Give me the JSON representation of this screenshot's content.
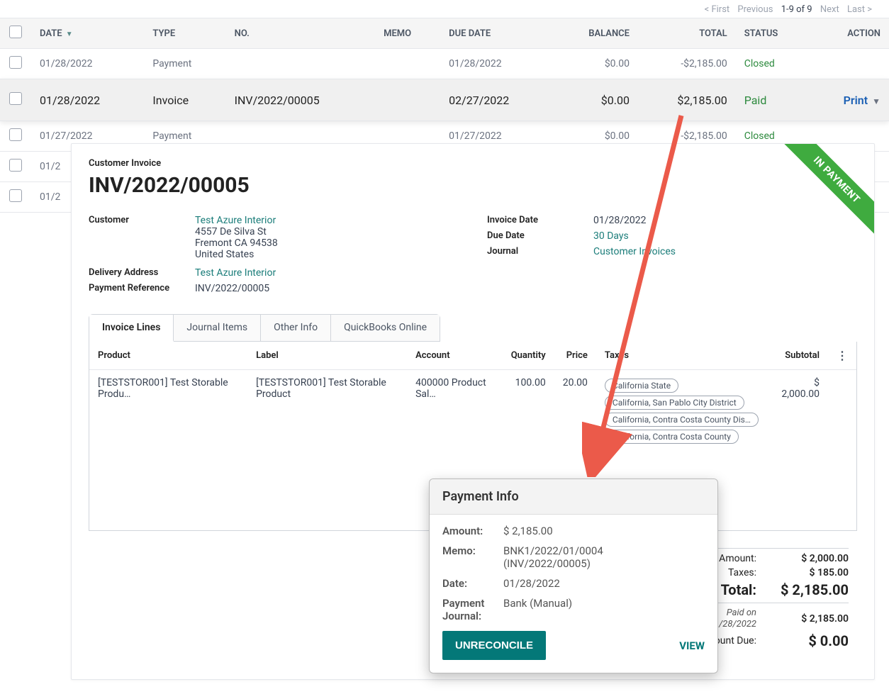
{
  "pagination": {
    "first": "< First",
    "previous": "Previous",
    "range": "1-9 of 9",
    "next": "Next",
    "last": "Last >"
  },
  "columns": {
    "date": "DATE",
    "type": "TYPE",
    "no": "NO.",
    "memo": "MEMO",
    "due_date": "DUE DATE",
    "balance": "BALANCE",
    "total": "TOTAL",
    "status": "STATUS",
    "action": "ACTION"
  },
  "rows": [
    {
      "date": "01/28/2022",
      "type": "Payment",
      "no": "",
      "memo": "",
      "due_date": "01/28/2022",
      "balance": "$0.00",
      "total": "-$2,185.00",
      "status": "Closed"
    },
    {
      "date": "01/28/2022",
      "type": "Invoice",
      "no": "INV/2022/00005",
      "memo": "",
      "due_date": "02/27/2022",
      "balance": "$0.00",
      "total": "$2,185.00",
      "status": "Paid",
      "action": "Print"
    },
    {
      "date": "01/27/2022",
      "type": "Payment",
      "no": "",
      "memo": "",
      "due_date": "01/27/2022",
      "balance": "$0.00",
      "total": "-$2,185.00",
      "status": "Closed"
    },
    {
      "date": "01/2"
    },
    {
      "date": "01/2"
    }
  ],
  "ribbon": "IN PAYMENT",
  "detail": {
    "heading_small": "Customer Invoice",
    "heading_big": "INV/2022/00005",
    "customer_label": "Customer",
    "customer_name": "Test Azure Interior",
    "addr1": "4557 De Silva St",
    "addr2": "Fremont CA 94538",
    "addr3": "United States",
    "delivery_label": "Delivery Address",
    "delivery_value": "Test Azure Interior",
    "payref_label": "Payment Reference",
    "payref_value": "INV/2022/00005",
    "invdate_label": "Invoice Date",
    "invdate_value": "01/28/2022",
    "duedate_label": "Due Date",
    "duedate_value": "30 Days",
    "journal_label": "Journal",
    "journal_value": "Customer Invoices"
  },
  "tabs": {
    "t1": "Invoice Lines",
    "t2": "Journal Items",
    "t3": "Other Info",
    "t4": "QuickBooks Online"
  },
  "line_cols": {
    "product": "Product",
    "label": "Label",
    "account": "Account",
    "quantity": "Quantity",
    "price": "Price",
    "taxes": "Taxes",
    "subtotal": "Subtotal"
  },
  "line": {
    "product": "[TESTSTOR001] Test Storable Produ…",
    "label": "[TESTSTOR001] Test Storable Product",
    "account": "400000 Product Sal…",
    "quantity": "100.00",
    "price": "20.00",
    "subtotal": "$ 2,000.00",
    "tax1": "California State",
    "tax2": "California, San Pablo City District",
    "tax3": "California, Contra Costa County Dis…",
    "tax4": "California, Contra Costa County"
  },
  "totals": {
    "untaxed_label": "Untaxed Amount:",
    "untaxed": "$ 2,000.00",
    "taxes_label": "Taxes:",
    "taxes": "$ 185.00",
    "total_label": "Total:",
    "total": "$ 2,185.00",
    "paid_on_label1": "Paid on",
    "paid_on_label2": "01/28/2022",
    "paid": "$ 2,185.00",
    "due_label": "Amount Due:",
    "due": "$ 0.00"
  },
  "popover": {
    "title": "Payment Info",
    "amount_label": "Amount:",
    "amount": "$ 2,185.00",
    "memo_label": "Memo:",
    "memo1": "BNK1/2022/01/0004",
    "memo2": "(INV/2022/00005)",
    "date_label": "Date:",
    "date": "01/28/2022",
    "journal_label": "Payment Journal:",
    "journal": "Bank (Manual)",
    "unreconcile": "UNRECONCILE",
    "view": "VIEW"
  }
}
